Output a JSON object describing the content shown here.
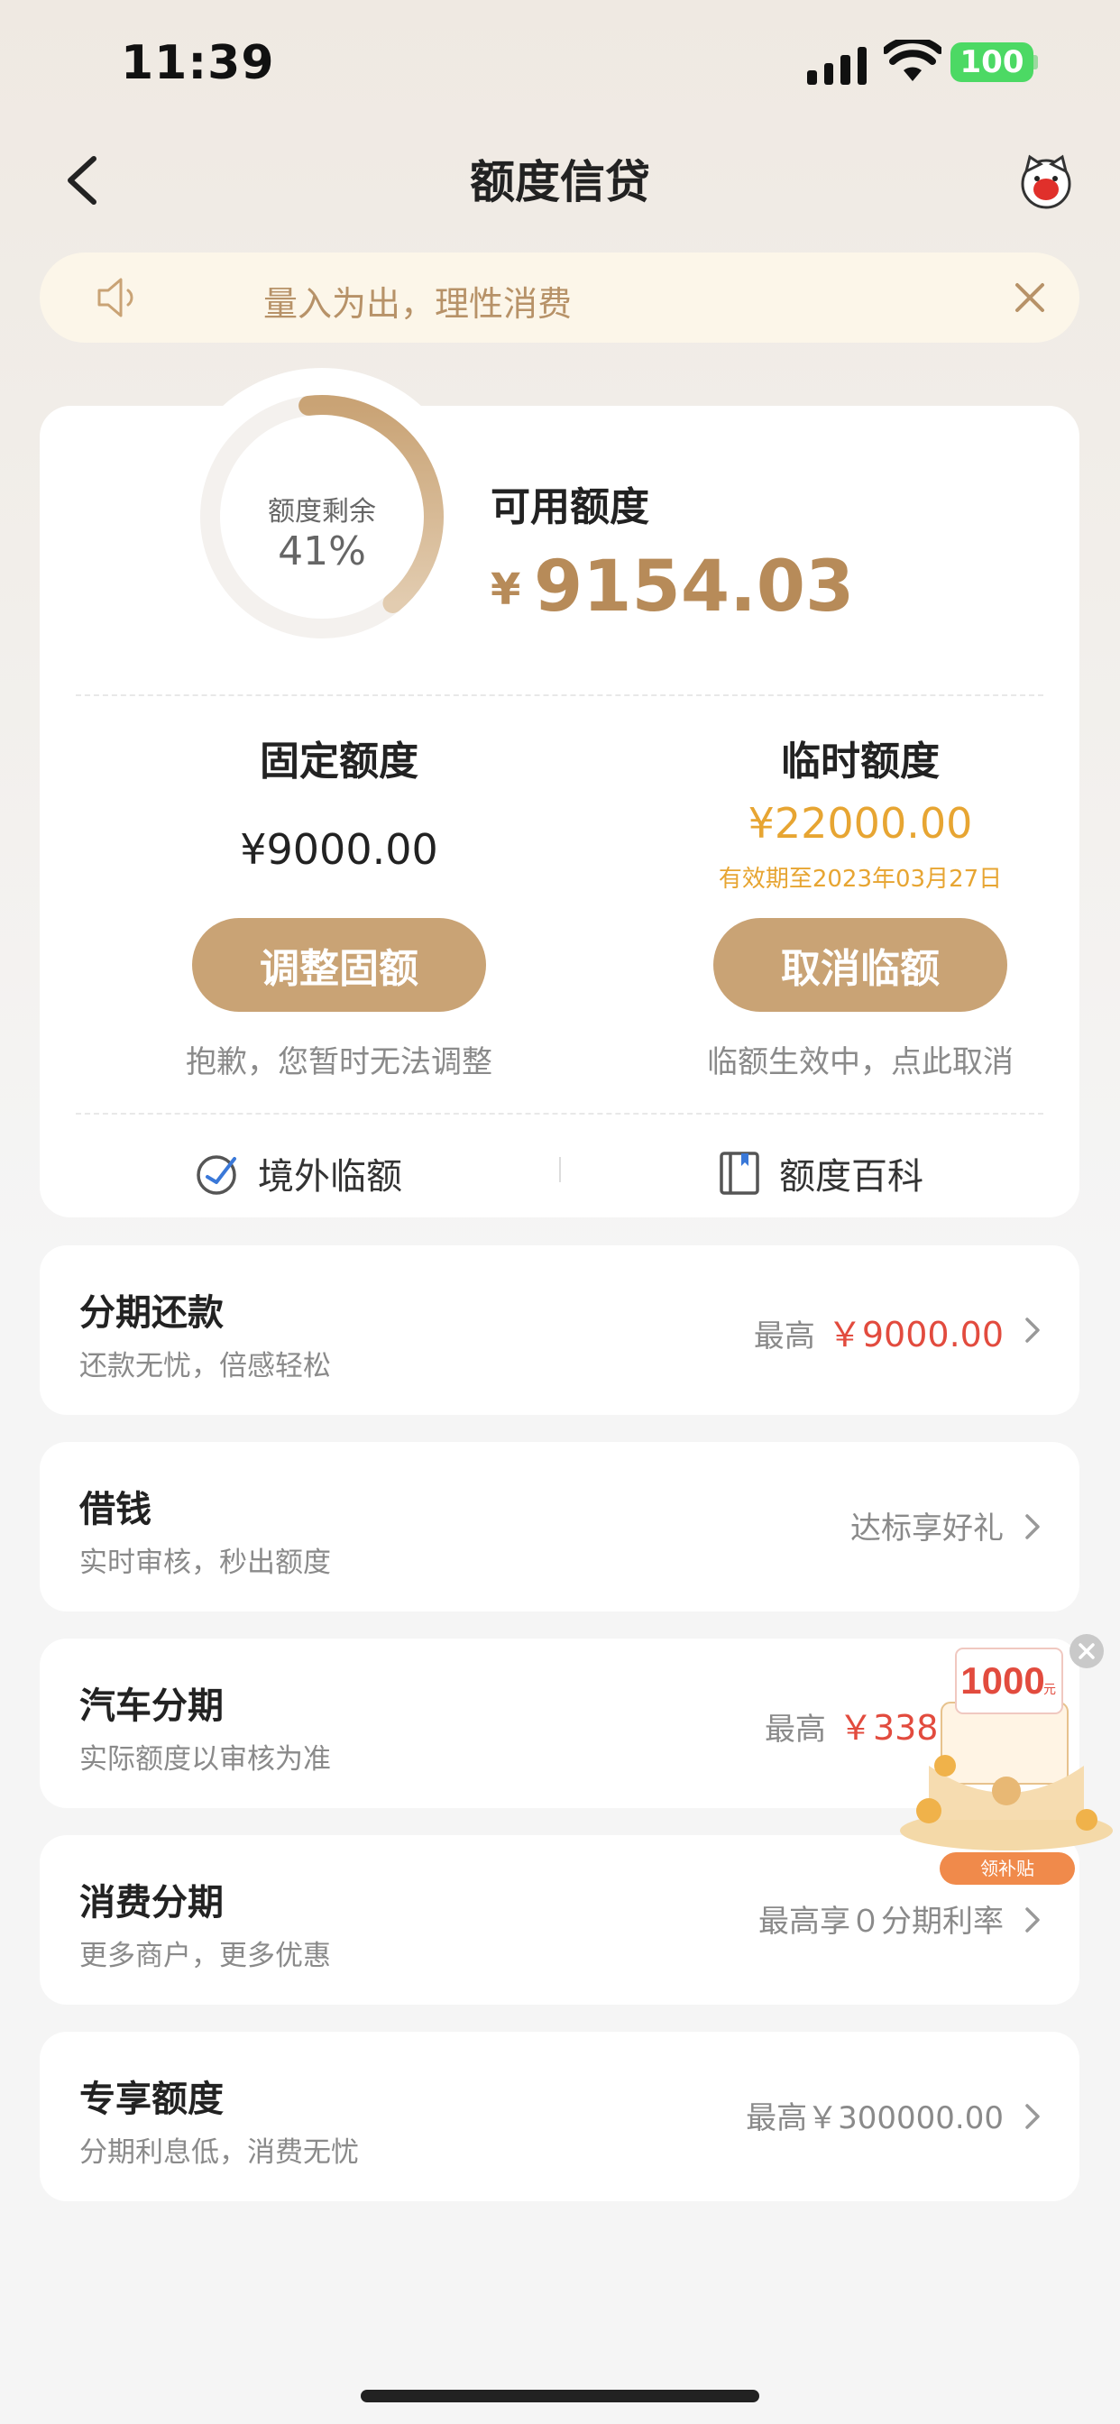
{
  "status_bar": {
    "time": "11:39",
    "battery": "100"
  },
  "nav": {
    "title": "额度信贷"
  },
  "notice": {
    "text": "量入为出，理性消费"
  },
  "credit": {
    "ring_label": "额度剩余",
    "ring_value": "41%",
    "remaining_fraction": 0.41,
    "available_label": "可用额度",
    "currency": "¥",
    "available_amount": "9154.03",
    "fixed": {
      "title": "固定额度",
      "amount": "¥9000.00",
      "button": "调整固额",
      "note": "抱歉，您暂时无法调整"
    },
    "temporary": {
      "title": "临时额度",
      "amount": "¥22000.00",
      "validity": "有效期至2023年03月27日",
      "button": "取消临额",
      "note": "临额生效中，点此取消"
    },
    "links": [
      {
        "label": "境外临额",
        "icon": "overseas-icon"
      },
      {
        "label": "额度百科",
        "icon": "book-icon"
      }
    ]
  },
  "list": [
    {
      "title": "分期还款",
      "subtitle": "还款无忧，倍感轻松",
      "prefix": "最高",
      "highlight": "￥9000.00",
      "text": ""
    },
    {
      "title": "借钱",
      "subtitle": "实时审核，秒出额度",
      "prefix": "",
      "highlight": "",
      "text": "达标享好礼"
    },
    {
      "title": "汽车分期",
      "subtitle": "实际额度以审核为准",
      "prefix": "最高",
      "highlight": "￥338000",
      "text": ""
    },
    {
      "title": "消费分期",
      "subtitle": "更多商户，更多优惠",
      "prefix": "",
      "highlight": "",
      "text": "最高享０分期利率"
    },
    {
      "title": "专享额度",
      "subtitle": "分期利息低，消费无忧",
      "prefix": "",
      "highlight": "",
      "text": "最高￥300000.00"
    }
  ],
  "promo": {
    "amount": "1000",
    "unit": "元",
    "label": "领补贴"
  },
  "colors": {
    "accent": "#c9a375",
    "gold_text": "#b78b59",
    "temp_orange": "#e7a532",
    "red": "#e24b3e"
  }
}
